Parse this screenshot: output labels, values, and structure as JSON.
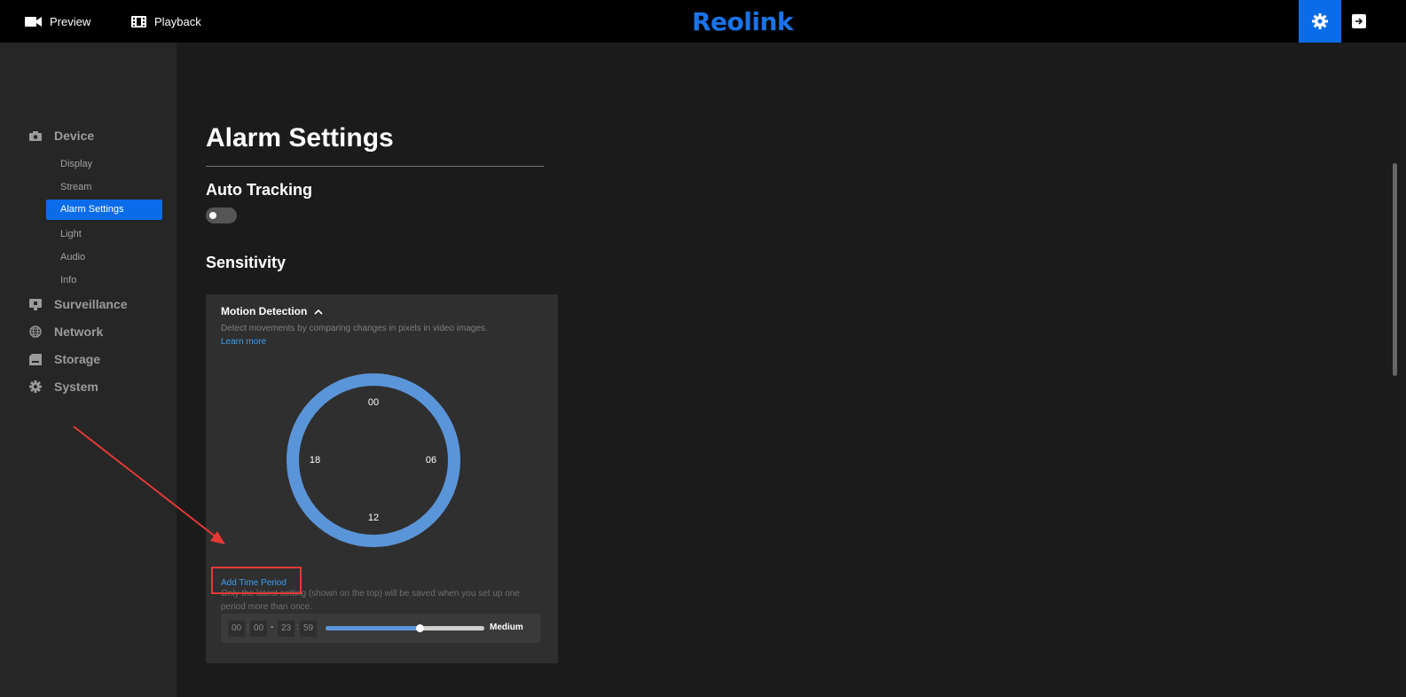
{
  "topbar": {
    "preview_label": "Preview",
    "playback_label": "Playback",
    "brand": "Reolink"
  },
  "sidebar": {
    "groups": [
      {
        "label": "Device",
        "icon": "camera-icon"
      },
      {
        "label": "Surveillance",
        "icon": "monitor-icon"
      },
      {
        "label": "Network",
        "icon": "globe-icon"
      },
      {
        "label": "Storage",
        "icon": "storage-icon"
      },
      {
        "label": "System",
        "icon": "gear-icon"
      }
    ],
    "device_items": [
      "Display",
      "Stream",
      "Alarm Settings",
      "Light",
      "Audio",
      "Info"
    ],
    "active_item": "Alarm Settings"
  },
  "main": {
    "title": "Alarm Settings",
    "auto_tracking": {
      "label": "Auto Tracking",
      "enabled": false
    },
    "sensitivity": {
      "label": "Sensitivity",
      "motion_detection": {
        "title": "Motion Detection",
        "description": "Detect movements by comparing changes in pixels in video images.",
        "learn_more": "Learn more",
        "clock_labels": {
          "top": "00",
          "right": "06",
          "bottom": "12",
          "left": "18"
        },
        "add_period_label": "Add Time Period",
        "note": "Only the latest setting (shown on the top) will be saved when you set up one period more than once.",
        "period": {
          "start_hour": "00",
          "start_minute": "00",
          "separator": "-",
          "end_hour": "23",
          "end_minute": "59",
          "level_label": "Medium",
          "slider_fraction": 0.59
        }
      }
    }
  },
  "colors": {
    "accent": "#0a6ce9",
    "clock_ring": "#5b95d9",
    "highlight_box": "#e53935",
    "link": "#3d9cf0"
  }
}
